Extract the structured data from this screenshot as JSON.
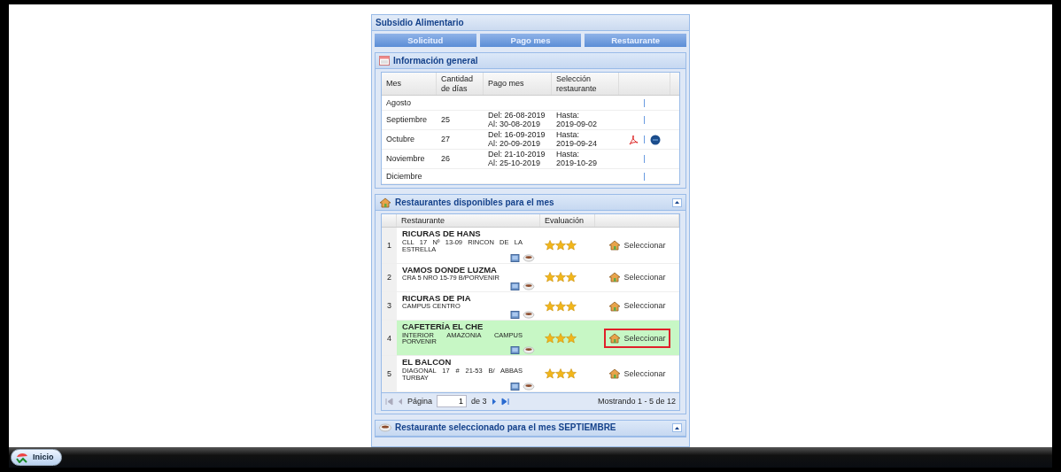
{
  "app": {
    "title": "Subsidio Alimentario"
  },
  "tabs": [
    {
      "label": "Solicitud"
    },
    {
      "label": "Pago mes"
    },
    {
      "label": "Restaurante"
    }
  ],
  "info_panel": {
    "title": "Información general",
    "columns": [
      "Mes",
      "Cantidad de días",
      "Pago mes",
      "Selección restaurante"
    ],
    "rows": [
      {
        "month": "Agosto",
        "days": "",
        "payment": [],
        "selection": [],
        "documents": false
      },
      {
        "month": "Septiembre",
        "days": "25",
        "payment": [
          "Del: 26-08-2019",
          "Al: 30-08-2019"
        ],
        "selection": [
          "Hasta:",
          "2019-09-02"
        ],
        "documents": false
      },
      {
        "month": "Octubre",
        "days": "27",
        "payment": [
          "Del: 16-09-2019",
          "Al: 20-09-2019"
        ],
        "selection": [
          "Hasta:",
          "2019-09-24"
        ],
        "documents": true
      },
      {
        "month": "Noviembre",
        "days": "26",
        "payment": [
          "Del: 21-10-2019",
          "Al: 25-10-2019"
        ],
        "selection": [
          "Hasta:",
          "2019-10-29"
        ],
        "documents": false
      },
      {
        "month": "Diciembre",
        "days": "",
        "payment": [],
        "selection": [],
        "documents": false
      }
    ]
  },
  "restaurants_panel": {
    "title": "Restaurantes disponibles para el mes",
    "columns": [
      "Restaurante",
      "Evaluación"
    ],
    "rows": [
      {
        "index": "1",
        "name": "RICURAS DE HANS",
        "address": "CLL 17 Nº 13-09 RINCON DE LA ESTRELLA",
        "stars": 3,
        "action": "Seleccionar",
        "selected": false,
        "highlighted": false
      },
      {
        "index": "2",
        "name": "VAMOS DONDE LUZMA",
        "address": "CRA 5 NRO 15-79 B/PORVENIR",
        "stars": 3,
        "action": "Seleccionar",
        "selected": false,
        "highlighted": false
      },
      {
        "index": "3",
        "name": "RICURAS DE PIA",
        "address": "CAMPUS CENTRO",
        "stars": 3,
        "action": "Seleccionar",
        "selected": false,
        "highlighted": false
      },
      {
        "index": "4",
        "name": "CAFETERÍA EL CHE",
        "address": "INTERIOR AMAZONIA CAMPUS PORVENIR",
        "stars": 3,
        "action": "Seleccionar",
        "selected": true,
        "highlighted": true
      },
      {
        "index": "5",
        "name": "EL BALCON",
        "address": "DIAGONAL 17 # 21-53 B/ ABBAS TURBAY",
        "stars": 3,
        "action": "Seleccionar",
        "selected": false,
        "highlighted": false
      }
    ],
    "pager": {
      "page_label": "Página",
      "page": "1",
      "of": "de 3",
      "summary": "Mostrando 1 - 5 de 12"
    }
  },
  "selected_panel": {
    "title": "Restaurante seleccionado para el mes SEPTIEMBRE"
  },
  "taskbar": {
    "start": "Inicio"
  }
}
